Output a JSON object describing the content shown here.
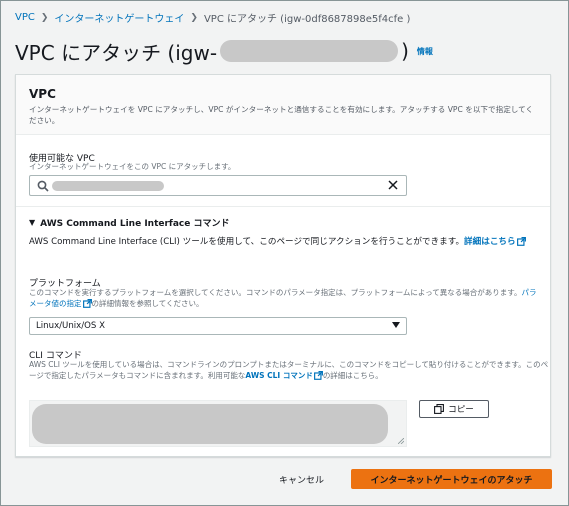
{
  "breadcrumb": {
    "items": [
      "VPC",
      "インターネットゲートウェイ"
    ],
    "current": "VPC にアタッチ (igw-0df8687898e5f4cfe )"
  },
  "header": {
    "title_prefix": "VPC にアタッチ (igw-",
    "title_suffix": ")",
    "info_link": "情報"
  },
  "panel": {
    "title": "VPC",
    "description": "インターネットゲートウェイを VPC にアタッチし、VPC がインターネットと通信することを有効にします。アタッチする VPC を以下で指定してください。",
    "vpc_field": {
      "label": "使用可能な VPC",
      "description": "インターネットゲートウェイをこの VPC にアタッチします。",
      "search_icon": "search-icon",
      "clear_icon": "close-icon"
    },
    "cli_section": {
      "header": "AWS Command Line Interface コマンド",
      "description_prefix": "AWS Command Line Interface (CLI) ツールを使用して、このページで同じアクションを行うことができます。",
      "details_link": "詳細はこちら",
      "platform": {
        "label": "プラットフォーム",
        "description_prefix": "このコマンドを実行するプラットフォームを選択してください。コマンドのパラメータ指定は、プラットフォームによって異なる場合があります。",
        "param_link": "パラメータ値の指定",
        "description_suffix": "の詳細情報を参照してください。",
        "selected": "Linux/Unix/OS X"
      },
      "cli_command": {
        "label": "CLI コマンド",
        "description_prefix": "AWS CLI ツールを使用している場合は、コマンドラインのプロンプトまたはターミナルに、このコマンドをコピーして貼り付けることができます。このページで指定したパラメータもコマンドに含まれます。利用可能な",
        "cli_link": "AWS CLI コマンド",
        "description_suffix": "の詳細はこちら。",
        "copy_label": "コピー"
      }
    }
  },
  "footer": {
    "cancel_label": "キャンセル",
    "submit_label": "インターネットゲートウェイのアタッチ"
  },
  "colors": {
    "link": "#0073bb",
    "primary": "#ec7211",
    "redaction": "#c8c8c8"
  }
}
